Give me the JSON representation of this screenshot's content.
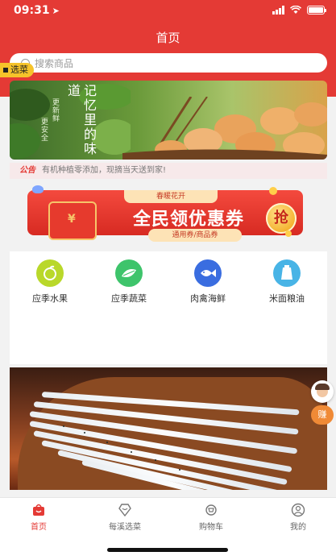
{
  "status_bar": {
    "time": "09:31"
  },
  "nav": {
    "title": "首页"
  },
  "search": {
    "placeholder": "搜索商品"
  },
  "side_tag": {
    "label": "选菜"
  },
  "banner": {
    "headline": "记忆里的味道",
    "sub_left": "更新鲜",
    "sub_right": "更安全"
  },
  "notice": {
    "label": "公告",
    "text": "有机种植零添加，现摘当天送到家!"
  },
  "coupon": {
    "top_label": "春暖花开",
    "title": "全民领优惠券",
    "sub": "通用券/商品券",
    "grab": "抢"
  },
  "categories": [
    {
      "label": "应季水果",
      "icon": "apple-icon",
      "color": "#b9d82a"
    },
    {
      "label": "应季蔬菜",
      "icon": "vegetable-icon",
      "color": "#3ec46b"
    },
    {
      "label": "肉禽海鲜",
      "icon": "fish-icon",
      "color": "#3a6de0"
    },
    {
      "label": "米面粮油",
      "icon": "oil-icon",
      "color": "#48b4e6"
    }
  ],
  "float_buttons": {
    "earn": "赚"
  },
  "tabs": [
    {
      "label": "首页",
      "icon": "home-bag-icon",
      "active": true
    },
    {
      "label": "每溪选菜",
      "icon": "heart-diamond-icon",
      "active": false
    },
    {
      "label": "购物车",
      "icon": "cart-icon",
      "active": false
    },
    {
      "label": "我的",
      "icon": "user-icon",
      "active": false
    }
  ],
  "colors": {
    "brand_red": "#e43a35",
    "tag_yellow": "#f6c32a",
    "earn_orange": "#f08a36"
  }
}
